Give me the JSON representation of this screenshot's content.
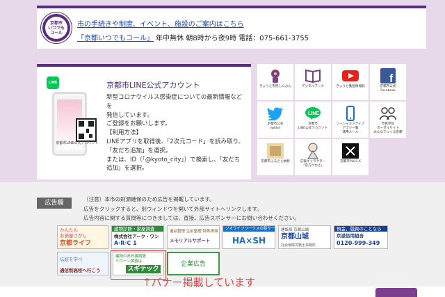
{
  "call_center": {
    "logo_text": [
      "京都市",
      "いつでも",
      "コール"
    ],
    "line1": "市の手続きや制度、イベント、施設のご案内はこちら",
    "link_label": "「京都いつでもコール」",
    "hours": " 年中無休 朝8時から夜9時",
    "phone": " 電話：075-661-3755"
  },
  "line_account": {
    "icon_label": "LINE",
    "title": "京都市LINE公式アカウント",
    "caption": "京都市LINE公式アカウント",
    "body": [
      "新型コロナウイルス感染症についての最新情報などを",
      "発信しています。",
      "ご登録をお願いします。",
      "【利用方法】",
      "LINEアプリを取得後、「2次元コード」を読み取り、",
      "「友だち追加」を選択。",
      "または、ID（「@kyoto_city」）で検索し、「友だち",
      "追加」を選択。"
    ]
  },
  "tiles": [
    {
      "icon": "mascot-icon",
      "label": "きょうと市民しんぶん"
    },
    {
      "icon": "book-icon",
      "label": "デジタルブック"
    },
    {
      "icon": "youtube-icon",
      "label": "きょうと動画情報館"
    },
    {
      "icon": "facebook-icon",
      "label": "京都市公式\nFacebook"
    },
    {
      "icon": "twitter-icon",
      "label": "京都市公式\ntwitter"
    },
    {
      "icon": "line-icon",
      "label": "京都市\nLINE公式アカウント"
    },
    {
      "icon": "smartphone-icon",
      "label": "ソーシャルメディア\nアプリ一覧\n運用ルール"
    },
    {
      "icon": "people-icon",
      "label": "市民参加\nポータルサイト\nみんなでつくる京都"
    },
    {
      "icon": "furusato-icon",
      "label": "京都市ふるさと納税"
    },
    {
      "icon": "character-icon",
      "label": "広報キャラクター\n「京乃つかさ」"
    },
    {
      "icon": "plusx-icon",
      "label": "京都市PLUS X"
    }
  ],
  "colors": {
    "purple": "#5b2d7f",
    "line_green": "#06c755",
    "twitter": "#1da1f2",
    "facebook": "#3b5998",
    "youtube": "#e62117",
    "annotation": "#d94848"
  },
  "ads": {
    "label": "広告欄",
    "notes": [
      "（注意）本市の財源確保のため広告を掲載しています。",
      "広告をクリックすると、別ウィンドウを開いて外部サイトへリンクします。",
      "広告内容に関する質問等につきましては、直接、広告スポンサーにお問い合わせください。"
    ],
    "banners": [
      {
        "l1": "かんたん",
        "l2": "お部屋さがし",
        "l3": "京都ライフ"
      },
      {
        "l1": "建物診断・家屋調査",
        "l2": "株式会社アーク・ワン",
        "l3": "A·R·C 1"
      },
      {
        "l1": "遺品整理 生前整理 特殊清掃",
        "l2": "メモリアルサポート",
        "l3": ""
      },
      {
        "l1": "ジオライフワークスの新サービス",
        "l2": "HA×SH",
        "l3": ""
      },
      {
        "l1": "建設局 京都山城",
        "l2": "京都山城",
        "l3": "社会保険労務士事務所"
      },
      {
        "l1": "預金、融資のことなら",
        "l2": "京滋信用組合",
        "l3": "0120-999-349"
      },
      {
        "l1": "伝統を学べ",
        "l2": "通信制高校へ行こう",
        "l3": ""
      },
      {
        "l1": "建物の赤外線調査",
        "l2": "ドローン調査は",
        "l3": "スギテック"
      },
      {
        "l1": "企業広告",
        "l2": "",
        "l3": ""
      }
    ],
    "annotation": "↑バナー掲載しています"
  }
}
